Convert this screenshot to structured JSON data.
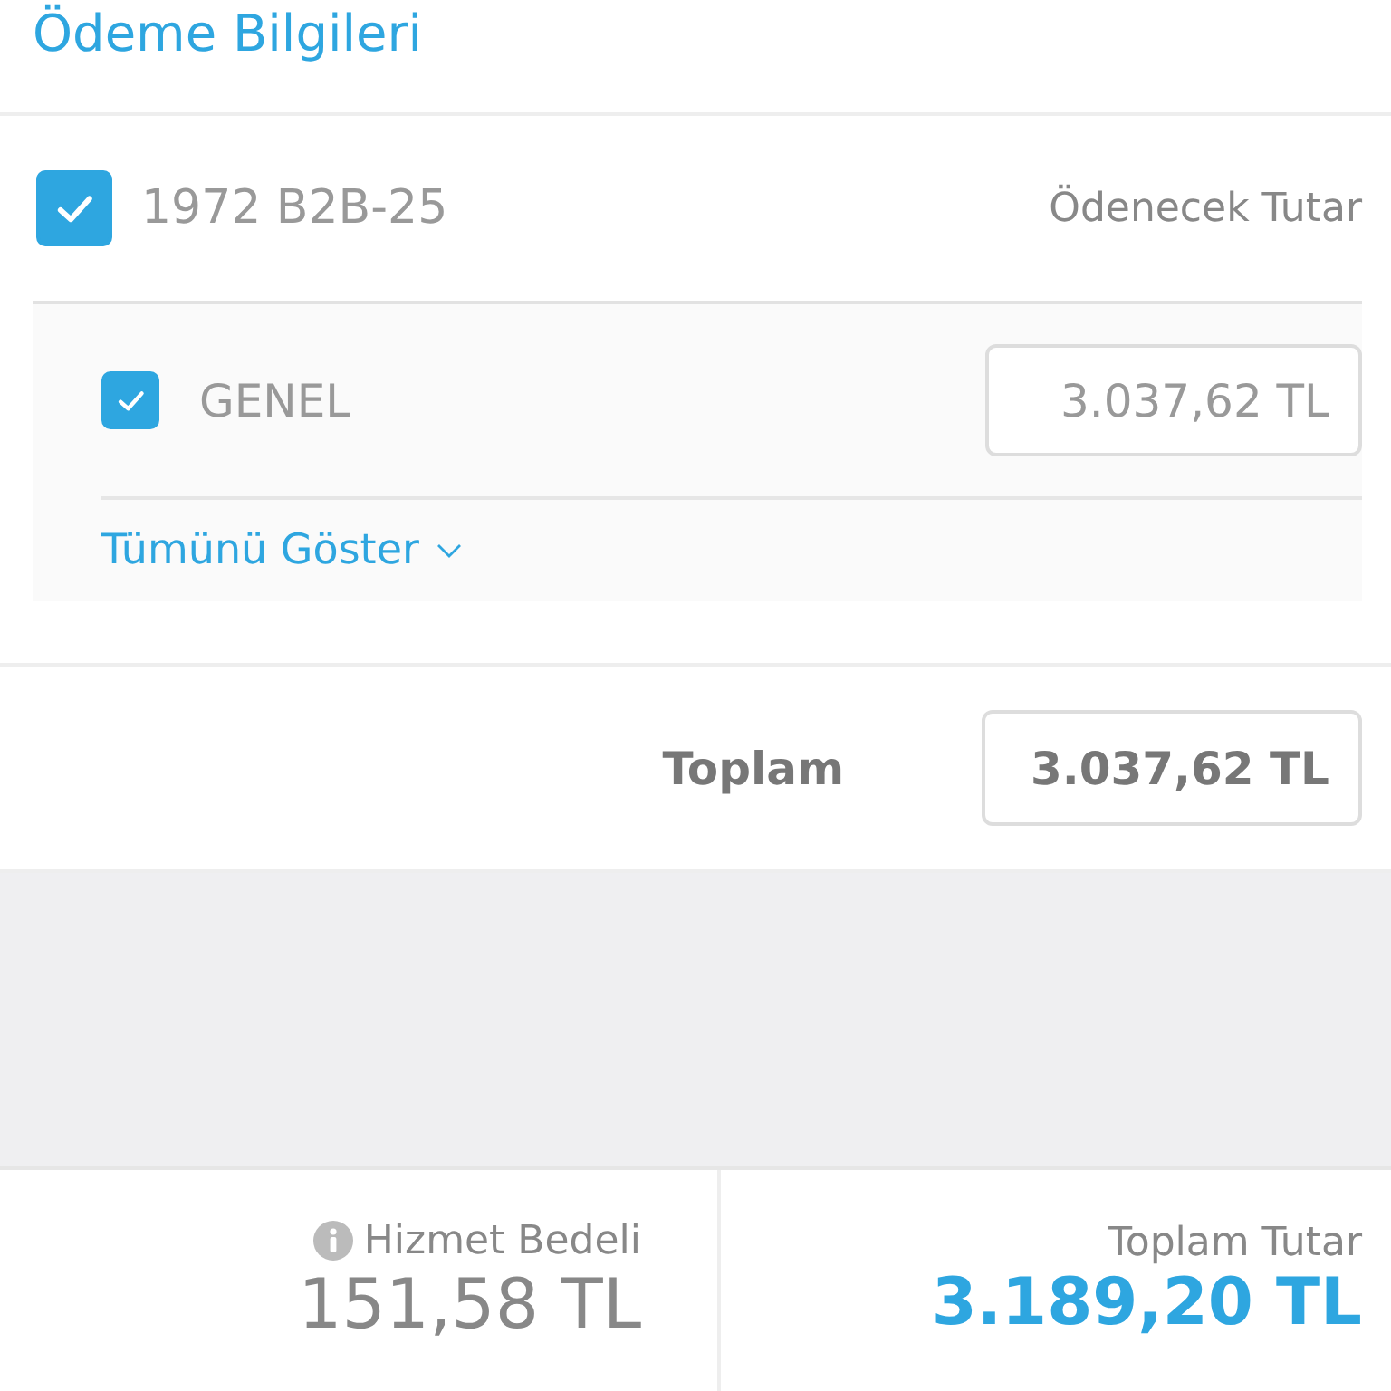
{
  "title": "Ödeme Bilgileri",
  "account": {
    "name": "1972 B2B-25",
    "checked": true,
    "amount_header": "Ödenecek Tutar"
  },
  "items": [
    {
      "name": "GENEL",
      "checked": true,
      "amount": "3.037,62 TL"
    }
  ],
  "show_all": "Tümünü Göster",
  "total": {
    "label": "Toplam",
    "value": "3.037,62 TL"
  },
  "footer": {
    "fee_label": "Hizmet Bedeli",
    "fee": "151,58 TL",
    "total_label": "Toplam Tutar",
    "total": "3.189,20 TL"
  }
}
